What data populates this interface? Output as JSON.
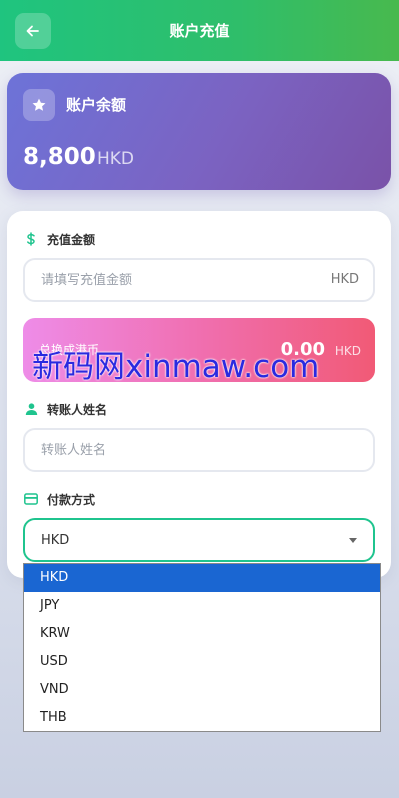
{
  "header": {
    "title": "账户充值",
    "back_icon": "arrow-left-icon"
  },
  "balance": {
    "label": "账户余额",
    "amount": "8,800",
    "currency": "HKD",
    "icon": "star-icon"
  },
  "form": {
    "amount_section": {
      "label": "充值金额",
      "icon": "dollar-icon",
      "placeholder": "请填写充值金额",
      "suffix": "HKD"
    },
    "conversion": {
      "label": "总换成港币",
      "amount": "0.00",
      "currency": "HKD"
    },
    "payer_section": {
      "label": "转账人姓名",
      "icon": "person-icon",
      "placeholder": "转账人姓名"
    },
    "payment_section": {
      "label": "付款方式",
      "icon": "credit-card-icon",
      "selected": "HKD",
      "options": [
        "HKD",
        "JPY",
        "KRW",
        "USD",
        "VND",
        "THB"
      ]
    }
  },
  "watermark": "新码网xinmaw.com",
  "colors": {
    "header_green": "#1fc47f",
    "accent_green": "#1fc48e",
    "balance_purple": "#7b63c2",
    "dropdown_selected": "#1a66d2",
    "watermark_blue": "#2a2ae0"
  }
}
